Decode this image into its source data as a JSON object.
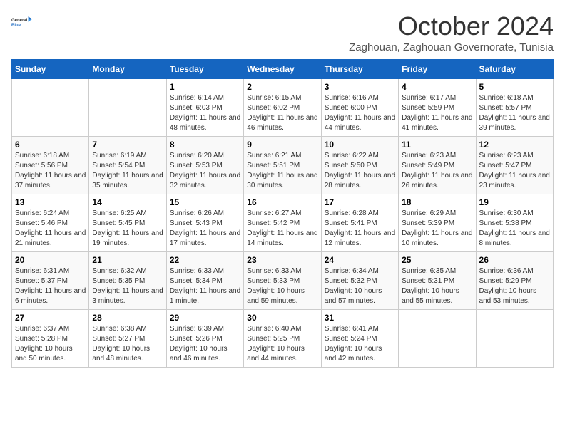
{
  "header": {
    "logo_line1": "General",
    "logo_line2": "Blue",
    "month_title": "October 2024",
    "location": "Zaghouan, Zaghouan Governorate, Tunisia"
  },
  "weekdays": [
    "Sunday",
    "Monday",
    "Tuesday",
    "Wednesday",
    "Thursday",
    "Friday",
    "Saturday"
  ],
  "weeks": [
    [
      {
        "day": "",
        "sunrise": "",
        "sunset": "",
        "daylight": ""
      },
      {
        "day": "",
        "sunrise": "",
        "sunset": "",
        "daylight": ""
      },
      {
        "day": "1",
        "sunrise": "Sunrise: 6:14 AM",
        "sunset": "Sunset: 6:03 PM",
        "daylight": "Daylight: 11 hours and 48 minutes."
      },
      {
        "day": "2",
        "sunrise": "Sunrise: 6:15 AM",
        "sunset": "Sunset: 6:02 PM",
        "daylight": "Daylight: 11 hours and 46 minutes."
      },
      {
        "day": "3",
        "sunrise": "Sunrise: 6:16 AM",
        "sunset": "Sunset: 6:00 PM",
        "daylight": "Daylight: 11 hours and 44 minutes."
      },
      {
        "day": "4",
        "sunrise": "Sunrise: 6:17 AM",
        "sunset": "Sunset: 5:59 PM",
        "daylight": "Daylight: 11 hours and 41 minutes."
      },
      {
        "day": "5",
        "sunrise": "Sunrise: 6:18 AM",
        "sunset": "Sunset: 5:57 PM",
        "daylight": "Daylight: 11 hours and 39 minutes."
      }
    ],
    [
      {
        "day": "6",
        "sunrise": "Sunrise: 6:18 AM",
        "sunset": "Sunset: 5:56 PM",
        "daylight": "Daylight: 11 hours and 37 minutes."
      },
      {
        "day": "7",
        "sunrise": "Sunrise: 6:19 AM",
        "sunset": "Sunset: 5:54 PM",
        "daylight": "Daylight: 11 hours and 35 minutes."
      },
      {
        "day": "8",
        "sunrise": "Sunrise: 6:20 AM",
        "sunset": "Sunset: 5:53 PM",
        "daylight": "Daylight: 11 hours and 32 minutes."
      },
      {
        "day": "9",
        "sunrise": "Sunrise: 6:21 AM",
        "sunset": "Sunset: 5:51 PM",
        "daylight": "Daylight: 11 hours and 30 minutes."
      },
      {
        "day": "10",
        "sunrise": "Sunrise: 6:22 AM",
        "sunset": "Sunset: 5:50 PM",
        "daylight": "Daylight: 11 hours and 28 minutes."
      },
      {
        "day": "11",
        "sunrise": "Sunrise: 6:23 AM",
        "sunset": "Sunset: 5:49 PM",
        "daylight": "Daylight: 11 hours and 26 minutes."
      },
      {
        "day": "12",
        "sunrise": "Sunrise: 6:23 AM",
        "sunset": "Sunset: 5:47 PM",
        "daylight": "Daylight: 11 hours and 23 minutes."
      }
    ],
    [
      {
        "day": "13",
        "sunrise": "Sunrise: 6:24 AM",
        "sunset": "Sunset: 5:46 PM",
        "daylight": "Daylight: 11 hours and 21 minutes."
      },
      {
        "day": "14",
        "sunrise": "Sunrise: 6:25 AM",
        "sunset": "Sunset: 5:45 PM",
        "daylight": "Daylight: 11 hours and 19 minutes."
      },
      {
        "day": "15",
        "sunrise": "Sunrise: 6:26 AM",
        "sunset": "Sunset: 5:43 PM",
        "daylight": "Daylight: 11 hours and 17 minutes."
      },
      {
        "day": "16",
        "sunrise": "Sunrise: 6:27 AM",
        "sunset": "Sunset: 5:42 PM",
        "daylight": "Daylight: 11 hours and 14 minutes."
      },
      {
        "day": "17",
        "sunrise": "Sunrise: 6:28 AM",
        "sunset": "Sunset: 5:41 PM",
        "daylight": "Daylight: 11 hours and 12 minutes."
      },
      {
        "day": "18",
        "sunrise": "Sunrise: 6:29 AM",
        "sunset": "Sunset: 5:39 PM",
        "daylight": "Daylight: 11 hours and 10 minutes."
      },
      {
        "day": "19",
        "sunrise": "Sunrise: 6:30 AM",
        "sunset": "Sunset: 5:38 PM",
        "daylight": "Daylight: 11 hours and 8 minutes."
      }
    ],
    [
      {
        "day": "20",
        "sunrise": "Sunrise: 6:31 AM",
        "sunset": "Sunset: 5:37 PM",
        "daylight": "Daylight: 11 hours and 6 minutes."
      },
      {
        "day": "21",
        "sunrise": "Sunrise: 6:32 AM",
        "sunset": "Sunset: 5:35 PM",
        "daylight": "Daylight: 11 hours and 3 minutes."
      },
      {
        "day": "22",
        "sunrise": "Sunrise: 6:33 AM",
        "sunset": "Sunset: 5:34 PM",
        "daylight": "Daylight: 11 hours and 1 minute."
      },
      {
        "day": "23",
        "sunrise": "Sunrise: 6:33 AM",
        "sunset": "Sunset: 5:33 PM",
        "daylight": "Daylight: 10 hours and 59 minutes."
      },
      {
        "day": "24",
        "sunrise": "Sunrise: 6:34 AM",
        "sunset": "Sunset: 5:32 PM",
        "daylight": "Daylight: 10 hours and 57 minutes."
      },
      {
        "day": "25",
        "sunrise": "Sunrise: 6:35 AM",
        "sunset": "Sunset: 5:31 PM",
        "daylight": "Daylight: 10 hours and 55 minutes."
      },
      {
        "day": "26",
        "sunrise": "Sunrise: 6:36 AM",
        "sunset": "Sunset: 5:29 PM",
        "daylight": "Daylight: 10 hours and 53 minutes."
      }
    ],
    [
      {
        "day": "27",
        "sunrise": "Sunrise: 6:37 AM",
        "sunset": "Sunset: 5:28 PM",
        "daylight": "Daylight: 10 hours and 50 minutes."
      },
      {
        "day": "28",
        "sunrise": "Sunrise: 6:38 AM",
        "sunset": "Sunset: 5:27 PM",
        "daylight": "Daylight: 10 hours and 48 minutes."
      },
      {
        "day": "29",
        "sunrise": "Sunrise: 6:39 AM",
        "sunset": "Sunset: 5:26 PM",
        "daylight": "Daylight: 10 hours and 46 minutes."
      },
      {
        "day": "30",
        "sunrise": "Sunrise: 6:40 AM",
        "sunset": "Sunset: 5:25 PM",
        "daylight": "Daylight: 10 hours and 44 minutes."
      },
      {
        "day": "31",
        "sunrise": "Sunrise: 6:41 AM",
        "sunset": "Sunset: 5:24 PM",
        "daylight": "Daylight: 10 hours and 42 minutes."
      },
      {
        "day": "",
        "sunrise": "",
        "sunset": "",
        "daylight": ""
      },
      {
        "day": "",
        "sunrise": "",
        "sunset": "",
        "daylight": ""
      }
    ]
  ]
}
